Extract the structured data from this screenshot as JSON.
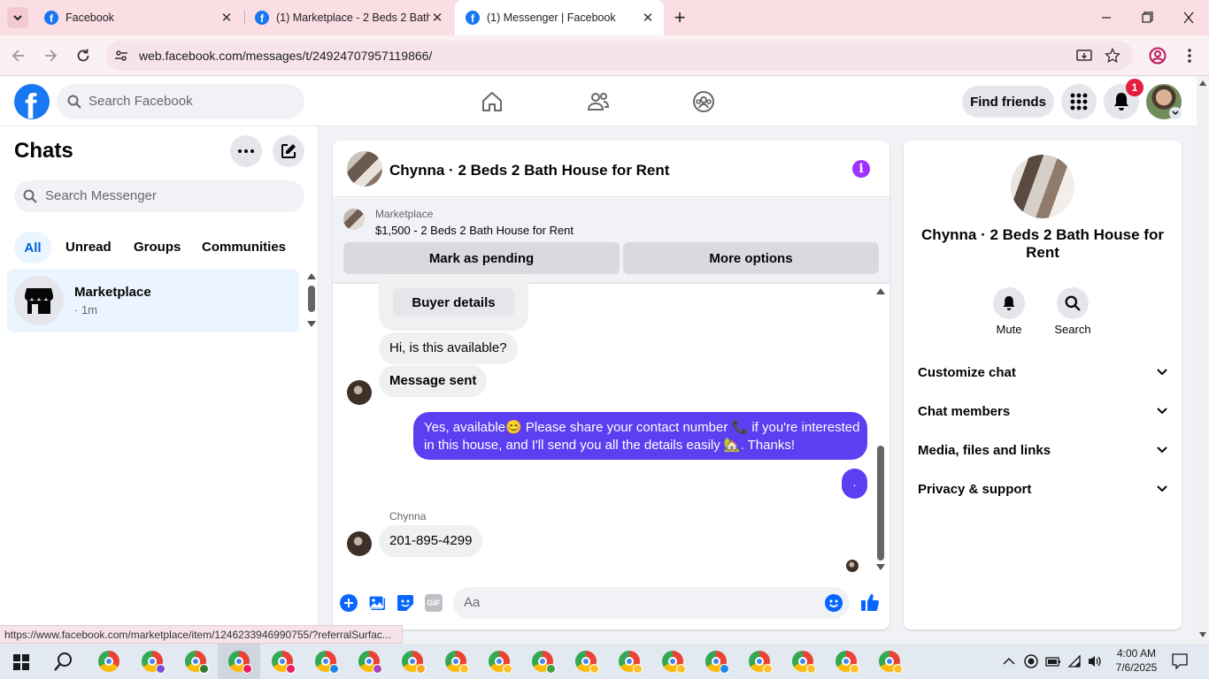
{
  "browser": {
    "tabs": [
      {
        "title": "Facebook"
      },
      {
        "title": "(1) Marketplace - 2 Beds 2 Bath"
      },
      {
        "title": "(1) Messenger | Facebook"
      }
    ],
    "url": "web.facebook.com/messages/t/24924707957119866/",
    "status_url": "https://www.facebook.com/marketplace/item/1246233946990755/?referralSurfac..."
  },
  "fb": {
    "search_placeholder": "Search Facebook",
    "find_friends": "Find friends",
    "notif_count": "1"
  },
  "chats": {
    "title": "Chats",
    "search_placeholder": "Search Messenger",
    "filters": [
      "All",
      "Unread",
      "Groups",
      "Communities"
    ],
    "items": [
      {
        "name": "Marketplace",
        "meta": "· 1m"
      }
    ]
  },
  "conversation": {
    "title": "Chynna · 2 Beds 2 Bath House for Rent",
    "listing_label": "Marketplace",
    "listing_title": "$1,500 - 2 Beds 2 Bath House for Rent",
    "mark_pending": "Mark as pending",
    "more_options": "More options",
    "buyer_details": "Buyer details",
    "msg1": "Hi, is this available?",
    "msg2": "Message sent",
    "out1_line1": "Yes, available😊 Please share your contact number 📞 if you're interested",
    "out1_line2": "in this house, and I'll send you all the details easily 🏡. Thanks!",
    "out2": ".",
    "sender_name": "Chynna",
    "msg3": "201-895-4299",
    "composer_placeholder": "Aa"
  },
  "details": {
    "name_line1": "Chynna · 2 Beds 2 Bath House for",
    "name_line2": "Rent",
    "mute": "Mute",
    "search": "Search",
    "sections": [
      "Customize chat",
      "Chat members",
      "Media, files and links",
      "Privacy & support"
    ]
  },
  "taskbar": {
    "time": "4:00 AM",
    "date": "7/6/2025"
  },
  "colors": {
    "fb_blue": "#1877f2",
    "outgoing_bubble": "#5b3ff0",
    "notif_red": "#e41e3f",
    "info_purple": "#a033ff"
  }
}
